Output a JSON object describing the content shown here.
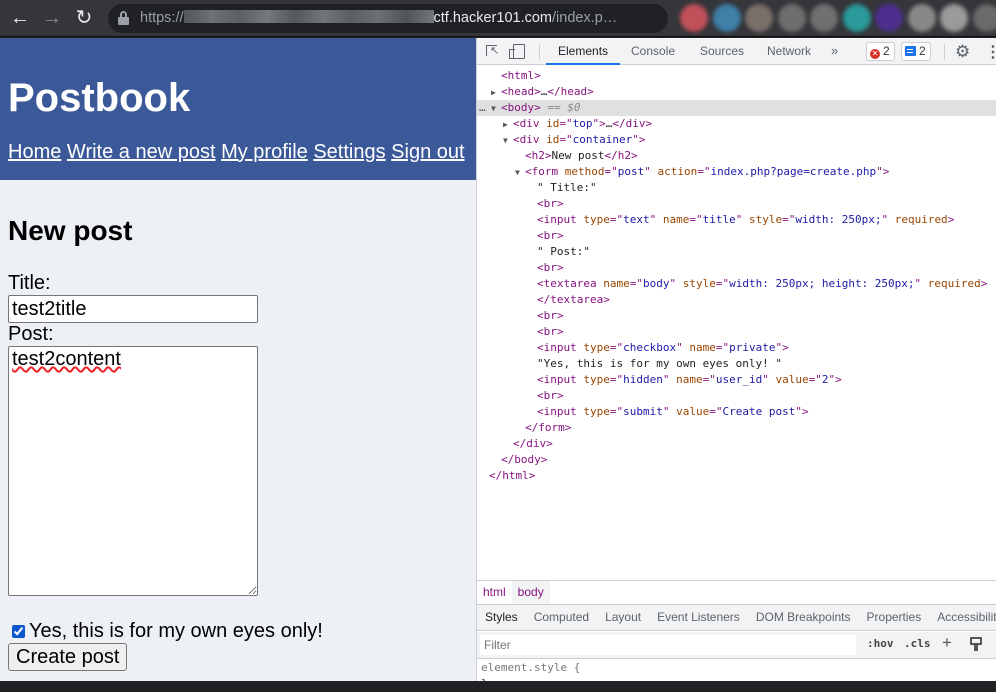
{
  "browser": {
    "url_prefix": "https://",
    "url_host": "ctf.hacker101.com",
    "url_path": "/index.p…",
    "icons": {
      "back": "back-arrow-icon",
      "forward": "forward-arrow-icon",
      "reload": "reload-icon",
      "lock": "lock-icon",
      "share": "share-icon",
      "bookmark": "star-icon"
    },
    "extension_colors": [
      "#c0505a",
      "#3f7fa8",
      "#7a706a",
      "#6e6e6e",
      "#707070",
      "#2a9a9a",
      "#4c2f8f",
      "#888888",
      "#9a9a9a",
      "#6a6a6a"
    ]
  },
  "page": {
    "brand_color": "#3b5998",
    "logo": "Postbook",
    "nav": [
      "Home",
      "Write a new post",
      "My profile",
      "Settings",
      "Sign out"
    ],
    "heading": "New post",
    "form": {
      "title_label": "Title:",
      "title_value": "test2title",
      "post_label": "Post:",
      "post_value": "test2content",
      "private_checked": true,
      "private_label": "Yes, this is for my own eyes only!",
      "submit_label": "Create post"
    }
  },
  "devtools": {
    "tabs": [
      "Elements",
      "Console",
      "Sources",
      "Network"
    ],
    "active_tab": "Elements",
    "more_tabs": "»",
    "error_count": "2",
    "message_count": "2",
    "dom_lines": [
      {
        "indent": 1,
        "tri": "",
        "parts": [
          [
            "tg",
            "<html>"
          ]
        ]
      },
      {
        "indent": 1,
        "tri": "▶",
        "parts": [
          [
            "tg",
            "<head>"
          ],
          [
            "tx",
            "…"
          ],
          [
            "tg",
            "</head>"
          ]
        ]
      },
      {
        "indent": 1,
        "tri": "▼",
        "sel": true,
        "parts": [
          [
            "tg",
            "<body>"
          ],
          [
            "eq",
            " == $0"
          ]
        ]
      },
      {
        "indent": 2,
        "tri": "▶",
        "parts": [
          [
            "tg",
            "<div "
          ],
          [
            "an",
            "id"
          ],
          [
            "tg",
            "=\""
          ],
          [
            "av",
            "top"
          ],
          [
            "tg",
            "\">"
          ],
          [
            "tx",
            "…"
          ],
          [
            "tg",
            "</div>"
          ]
        ]
      },
      {
        "indent": 2,
        "tri": "▼",
        "parts": [
          [
            "tg",
            "<div "
          ],
          [
            "an",
            "id"
          ],
          [
            "tg",
            "=\""
          ],
          [
            "av",
            "container"
          ],
          [
            "tg",
            "\">"
          ]
        ]
      },
      {
        "indent": 3,
        "tri": "",
        "parts": [
          [
            "tg",
            "<h2>"
          ],
          [
            "tx",
            "New post"
          ],
          [
            "tg",
            "</h2>"
          ]
        ]
      },
      {
        "indent": 3,
        "tri": "▼",
        "parts": [
          [
            "tg",
            "<form "
          ],
          [
            "an",
            "method"
          ],
          [
            "tg",
            "=\""
          ],
          [
            "av",
            "post"
          ],
          [
            "tg",
            "\" "
          ],
          [
            "an",
            "action"
          ],
          [
            "tg",
            "=\""
          ],
          [
            "av",
            "index.php?page=create.php"
          ],
          [
            "tg",
            "\">"
          ]
        ]
      },
      {
        "indent": 4,
        "tri": "",
        "parts": [
          [
            "tx",
            "\" Title:\""
          ]
        ]
      },
      {
        "indent": 4,
        "tri": "",
        "parts": [
          [
            "tg",
            "<br>"
          ]
        ]
      },
      {
        "indent": 4,
        "tri": "",
        "parts": [
          [
            "tg",
            "<input "
          ],
          [
            "an",
            "type"
          ],
          [
            "tg",
            "=\""
          ],
          [
            "av",
            "text"
          ],
          [
            "tg",
            "\" "
          ],
          [
            "an",
            "name"
          ],
          [
            "tg",
            "=\""
          ],
          [
            "av",
            "title"
          ],
          [
            "tg",
            "\" "
          ],
          [
            "an",
            "style"
          ],
          [
            "tg",
            "=\""
          ],
          [
            "av",
            "width: 250px;"
          ],
          [
            "tg",
            "\" "
          ],
          [
            "an",
            "required"
          ],
          [
            "tg",
            ">"
          ]
        ]
      },
      {
        "indent": 4,
        "tri": "",
        "parts": [
          [
            "tg",
            "<br>"
          ]
        ]
      },
      {
        "indent": 4,
        "tri": "",
        "parts": [
          [
            "tx",
            "\" Post:\""
          ]
        ]
      },
      {
        "indent": 4,
        "tri": "",
        "parts": [
          [
            "tg",
            "<br>"
          ]
        ]
      },
      {
        "indent": 4,
        "tri": "",
        "parts": [
          [
            "tg",
            "<textarea "
          ],
          [
            "an",
            "name"
          ],
          [
            "tg",
            "=\""
          ],
          [
            "av",
            "body"
          ],
          [
            "tg",
            "\" "
          ],
          [
            "an",
            "style"
          ],
          [
            "tg",
            "=\""
          ],
          [
            "av",
            "width: 250px; height: 250px;"
          ],
          [
            "tg",
            "\" "
          ],
          [
            "an",
            "required"
          ],
          [
            "tg",
            ">"
          ]
        ]
      },
      {
        "indent": 4,
        "tri": "",
        "parts": [
          [
            "tg",
            "</textarea>"
          ]
        ]
      },
      {
        "indent": 4,
        "tri": "",
        "parts": [
          [
            "tg",
            "<br>"
          ]
        ]
      },
      {
        "indent": 4,
        "tri": "",
        "parts": [
          [
            "tg",
            "<br>"
          ]
        ]
      },
      {
        "indent": 4,
        "tri": "",
        "parts": [
          [
            "tg",
            "<input "
          ],
          [
            "an",
            "type"
          ],
          [
            "tg",
            "=\""
          ],
          [
            "av",
            "checkbox"
          ],
          [
            "tg",
            "\" "
          ],
          [
            "an",
            "name"
          ],
          [
            "tg",
            "=\""
          ],
          [
            "av",
            "private"
          ],
          [
            "tg",
            "\">"
          ]
        ]
      },
      {
        "indent": 4,
        "tri": "",
        "parts": [
          [
            "tx",
            "\"Yes, this is for my own eyes only! \""
          ]
        ]
      },
      {
        "indent": 4,
        "tri": "",
        "parts": [
          [
            "tg",
            "<input "
          ],
          [
            "an",
            "type"
          ],
          [
            "tg",
            "=\""
          ],
          [
            "av",
            "hidden"
          ],
          [
            "tg",
            "\" "
          ],
          [
            "an",
            "name"
          ],
          [
            "tg",
            "=\""
          ],
          [
            "av",
            "user_id"
          ],
          [
            "tg",
            "\" "
          ],
          [
            "an",
            "value"
          ],
          [
            "tg",
            "=\""
          ],
          [
            "av",
            "2"
          ],
          [
            "tg",
            "\">"
          ]
        ]
      },
      {
        "indent": 4,
        "tri": "",
        "parts": [
          [
            "tg",
            "<br>"
          ]
        ]
      },
      {
        "indent": 4,
        "tri": "",
        "parts": [
          [
            "tg",
            "<input "
          ],
          [
            "an",
            "type"
          ],
          [
            "tg",
            "=\""
          ],
          [
            "av",
            "submit"
          ],
          [
            "tg",
            "\" "
          ],
          [
            "an",
            "value"
          ],
          [
            "tg",
            "=\""
          ],
          [
            "av",
            "Create post"
          ],
          [
            "tg",
            "\">"
          ]
        ]
      },
      {
        "indent": 3,
        "tri": "",
        "parts": [
          [
            "tg",
            "</form>"
          ]
        ]
      },
      {
        "indent": 2,
        "tri": "",
        "parts": [
          [
            "tg",
            "</div>"
          ]
        ]
      },
      {
        "indent": 1,
        "tri": "",
        "parts": [
          [
            "tg",
            "</body>"
          ]
        ]
      },
      {
        "indent": 0,
        "tri": "",
        "parts": [
          [
            "tg",
            "</html>"
          ]
        ]
      }
    ],
    "breadcrumbs": [
      "html",
      "body"
    ],
    "active_breadcrumb": "body",
    "style_tabs": [
      "Styles",
      "Computed",
      "Layout",
      "Event Listeners",
      "DOM Breakpoints",
      "Properties",
      "Accessibility"
    ],
    "active_style_tab": "Styles",
    "filter_placeholder": "Filter",
    "hov_label": ":hov",
    "cls_label": ".cls",
    "element_style": "element.style {",
    "element_style_close": "}"
  }
}
